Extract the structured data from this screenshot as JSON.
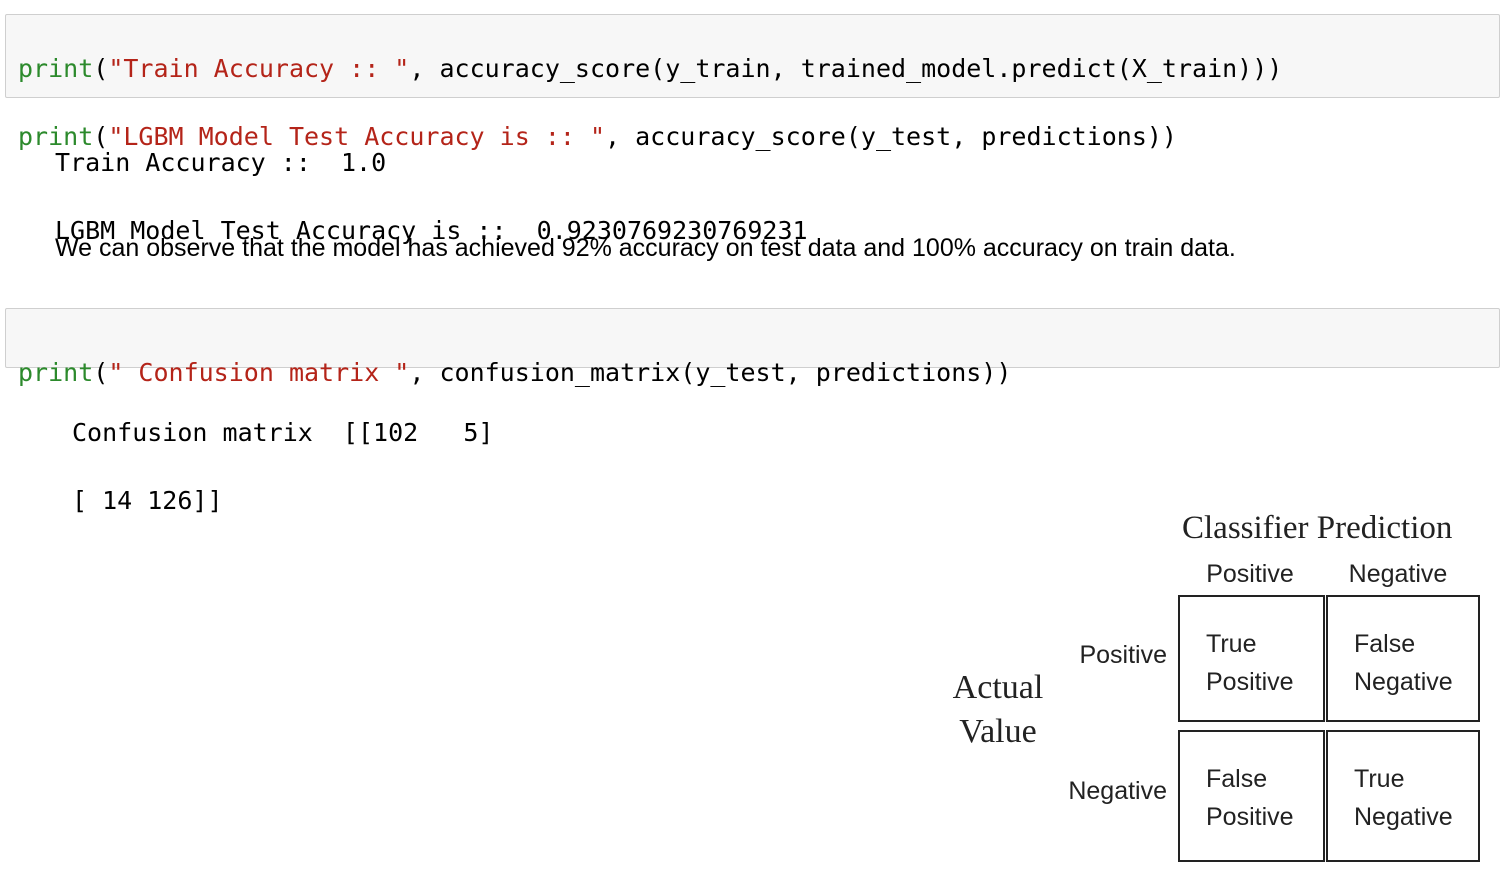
{
  "cells": [
    {
      "lines": [
        {
          "fn": "print",
          "open": "(",
          "str": "\"Train Accuracy :: \"",
          "rest": ", accuracy_score(y_train, trained_model.predict(X_train)))"
        },
        {
          "fn": "print",
          "open": "(",
          "str": "\"LGBM Model Test Accuracy is :: \"",
          "rest": ", accuracy_score(y_test, predictions))"
        }
      ],
      "output": [
        "Train Accuracy ::  1.0",
        "LGBM Model Test Accuracy is ::  0.9230769230769231"
      ]
    },
    {
      "lines": [
        {
          "fn": "print",
          "open": "(",
          "str": "\" Confusion matrix \"",
          "rest": ", confusion_matrix(y_test, predictions))"
        }
      ],
      "output": [
        "Confusion matrix  [[102   5]",
        "[ 14 126]]"
      ]
    }
  ],
  "markdown": "We can observe that the model has achieved 92% accuracy on test data and 100% accuracy on train data.",
  "confusion_figure": {
    "title": "Classifier Prediction",
    "col_headers": [
      "Positive",
      "Negative"
    ],
    "row_headers": [
      "Positive",
      "Negative"
    ],
    "axis_label_line1": "Actual",
    "axis_label_line2": "Value",
    "cells": [
      [
        "True\nPositive",
        "False\nNegative"
      ],
      [
        "False\nPositive",
        "True\nNegative"
      ]
    ]
  }
}
